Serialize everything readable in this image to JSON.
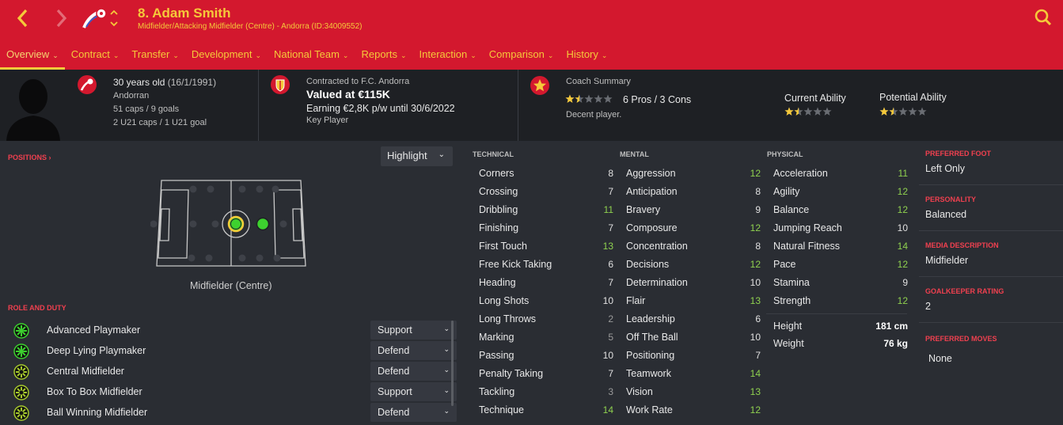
{
  "header": {
    "title": "8. Adam Smith",
    "subtitle": "Midfielder/Attacking Midfielder (Centre) - Andorra (ID:34009552)",
    "back_icon": "chevron-left-icon",
    "forward_icon": "chevron-right-icon",
    "search_icon": "search-icon"
  },
  "tabs": [
    {
      "label": "Overview"
    },
    {
      "label": "Contract"
    },
    {
      "label": "Transfer"
    },
    {
      "label": "Development"
    },
    {
      "label": "National Team"
    },
    {
      "label": "Reports"
    },
    {
      "label": "Interaction"
    },
    {
      "label": "Comparison"
    },
    {
      "label": "History"
    }
  ],
  "info": {
    "age": "30 years old",
    "dob": "(16/1/1991)",
    "nationality": "Andorran",
    "caps": "51 caps / 9 goals",
    "u21": "2 U21 caps / 1 U21 goal",
    "contracted_to": "Contracted to F.C. Andorra",
    "valued": "Valued at €115K",
    "earning": "Earning €2,8K p/w until 30/6/2022",
    "status": "Key Player",
    "coach_summary_label": "Coach Summary",
    "pros_cons": "6 Pros / 3 Cons",
    "coach_text": "Decent player.",
    "current_ability_label": "Current Ability",
    "potential_ability_label": "Potential Ability",
    "coach_stars": 1.5,
    "current_stars": 1.5,
    "potential_stars": 1.5,
    "max_stars": 5
  },
  "positions": {
    "label": "POSITIONS",
    "highlight": "Highlight",
    "position_name": "Midfielder (Centre)"
  },
  "role_and_duty": {
    "label": "ROLE AND DUTY",
    "roles": [
      {
        "name": "Advanced Playmaker",
        "duty": "Support"
      },
      {
        "name": "Deep Lying Playmaker",
        "duty": "Defend"
      },
      {
        "name": "Central Midfielder",
        "duty": "Defend"
      },
      {
        "name": "Box To Box Midfielder",
        "duty": "Support"
      },
      {
        "name": "Ball Winning Midfielder",
        "duty": "Defend"
      }
    ]
  },
  "attributes": {
    "technical_label": "TECHNICAL",
    "mental_label": "MENTAL",
    "physical_label": "PHYSICAL",
    "technical": [
      {
        "name": "Corners",
        "value": "8"
      },
      {
        "name": "Crossing",
        "value": "7"
      },
      {
        "name": "Dribbling",
        "value": "11"
      },
      {
        "name": "Finishing",
        "value": "7"
      },
      {
        "name": "First Touch",
        "value": "13"
      },
      {
        "name": "Free Kick Taking",
        "value": "6"
      },
      {
        "name": "Heading",
        "value": "7"
      },
      {
        "name": "Long Shots",
        "value": "10"
      },
      {
        "name": "Long Throws",
        "value": "2"
      },
      {
        "name": "Marking",
        "value": "5"
      },
      {
        "name": "Passing",
        "value": "10"
      },
      {
        "name": "Penalty Taking",
        "value": "7"
      },
      {
        "name": "Tackling",
        "value": "3"
      },
      {
        "name": "Technique",
        "value": "14"
      }
    ],
    "mental": [
      {
        "name": "Aggression",
        "value": "12"
      },
      {
        "name": "Anticipation",
        "value": "8"
      },
      {
        "name": "Bravery",
        "value": "9"
      },
      {
        "name": "Composure",
        "value": "12"
      },
      {
        "name": "Concentration",
        "value": "8"
      },
      {
        "name": "Decisions",
        "value": "12"
      },
      {
        "name": "Determination",
        "value": "10"
      },
      {
        "name": "Flair",
        "value": "13"
      },
      {
        "name": "Leadership",
        "value": "6"
      },
      {
        "name": "Off The Ball",
        "value": "10"
      },
      {
        "name": "Positioning",
        "value": "7"
      },
      {
        "name": "Teamwork",
        "value": "14"
      },
      {
        "name": "Vision",
        "value": "13"
      },
      {
        "name": "Work Rate",
        "value": "12"
      }
    ],
    "physical": [
      {
        "name": "Acceleration",
        "value": "11"
      },
      {
        "name": "Agility",
        "value": "12"
      },
      {
        "name": "Balance",
        "value": "12"
      },
      {
        "name": "Jumping Reach",
        "value": "10"
      },
      {
        "name": "Natural Fitness",
        "value": "14"
      },
      {
        "name": "Pace",
        "value": "12"
      },
      {
        "name": "Stamina",
        "value": "9"
      },
      {
        "name": "Strength",
        "value": "12"
      }
    ],
    "height_label": "Height",
    "height": "181 cm",
    "weight_label": "Weight",
    "weight": "76 kg"
  },
  "details": {
    "preferred_foot_label": "PREFERRED FOOT",
    "preferred_foot": "Left Only",
    "personality_label": "PERSONALITY",
    "personality": "Balanced",
    "media_label": "MEDIA DESCRIPTION",
    "media": "Midfielder",
    "gk_label": "GOALKEEPER RATING",
    "gk": "2",
    "moves_label": "PREFERRED MOVES",
    "moves": "None"
  },
  "colors": {
    "brand_red": "#d3182e",
    "accent_yellow": "#f5c93a",
    "good_value": "#8fd14f"
  }
}
